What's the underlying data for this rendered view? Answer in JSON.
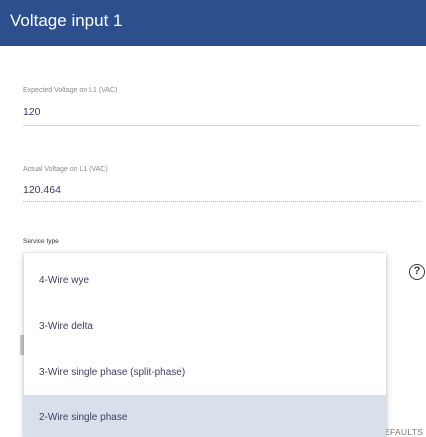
{
  "header": {
    "title": "Voltage input 1",
    "color": "#2d4f8e"
  },
  "expected_voltage": {
    "label": "Expected Voltage on L1 (VAC)",
    "value": "120"
  },
  "actual_voltage": {
    "label": "Actual Voltage on L1 (VAC)",
    "value": "120.464"
  },
  "service_type": {
    "label": "Service type",
    "options": [
      {
        "label": "4-Wire wye",
        "selected": false
      },
      {
        "label": "3-Wire delta",
        "selected": false
      },
      {
        "label": "3-Wire single phase (split-phase)",
        "selected": false
      },
      {
        "label": "2-Wire single phase",
        "selected": true
      }
    ],
    "help_icon": "help-circle-icon"
  },
  "footer": {
    "defaults_label": "EFAULTS"
  }
}
